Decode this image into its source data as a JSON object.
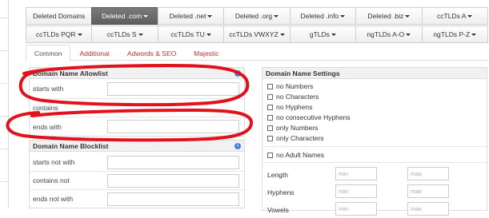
{
  "tld_buttons": {
    "row1": [
      {
        "label": "Deleted Domains",
        "caret": false,
        "active": false
      },
      {
        "label": "Deleted .com",
        "caret": true,
        "active": true
      },
      {
        "label": "Deleted .net",
        "caret": true,
        "active": false
      },
      {
        "label": "Deleted .org",
        "caret": true,
        "active": false
      },
      {
        "label": "Deleted .info",
        "caret": true,
        "active": false
      },
      {
        "label": "Deleted .biz",
        "caret": true,
        "active": false
      },
      {
        "label": "ccTLDs A",
        "caret": true,
        "active": false
      }
    ],
    "row2": [
      {
        "label": "ccTLDs PQR",
        "caret": true,
        "active": false
      },
      {
        "label": "ccTLDs S",
        "caret": true,
        "active": false
      },
      {
        "label": "ccTLDs TU",
        "caret": true,
        "active": false
      },
      {
        "label": "ccTLDs VWXYZ",
        "caret": true,
        "active": false
      },
      {
        "label": "gTLDs",
        "caret": true,
        "active": false
      },
      {
        "label": "ngTLDs A-O",
        "caret": true,
        "active": false
      },
      {
        "label": "ngTLDs P-Z",
        "caret": true,
        "active": false
      }
    ]
  },
  "tabs": [
    {
      "label": "Common",
      "active": true
    },
    {
      "label": "Additional",
      "active": false
    },
    {
      "label": "Adwords & SEO",
      "active": false
    },
    {
      "label": "Majestic",
      "active": false
    }
  ],
  "allowlist": {
    "title": "Domain Name Allowlist",
    "starts_with": "starts with",
    "contains": "contains",
    "ends_with": "ends with"
  },
  "blocklist": {
    "title": "Domain Name Blocklist",
    "starts_not_with": "starts not with",
    "contains_not": "contains not",
    "ends_not_with": "ends not with"
  },
  "settings": {
    "title": "Domain Name Settings",
    "checkboxes": [
      "no Numbers",
      "no Characters",
      "no Hyphens",
      "no consecutive Hyphens",
      "only Numbers",
      "only Characters"
    ],
    "adult": "no Adult Names",
    "length_label": "Length",
    "hyphens_label": "Hyphens",
    "vowels_label": "Vowels",
    "min_placeholder": "min",
    "max_placeholder": "max"
  },
  "colors": {
    "annotation": "#e0121b",
    "tab_link": "#c9302c",
    "active_button": "#666666",
    "info_icon": "#4a7fd4"
  }
}
